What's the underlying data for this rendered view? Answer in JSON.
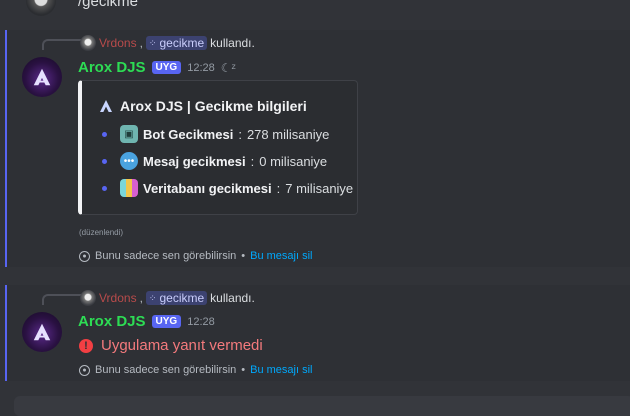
{
  "previous": {
    "text": "/gecikme"
  },
  "messages": [
    {
      "ref_user": "Vrdons",
      "ref_comma": ",",
      "ref_command": "gecikme",
      "ref_action": "kullandı.",
      "author": "Arox DJS",
      "tag": "UYG",
      "time": "12:28",
      "embed": {
        "title": "Arox DJS | Gecikme bilgileri",
        "items": [
          {
            "label": "Bot Gecikmesi",
            "sep": ":",
            "value": "278 milisaniye",
            "icon": "robot-emoji-icon"
          },
          {
            "label": "Mesaj gecikmesi",
            "sep": ":",
            "value": "0 milisaniye",
            "icon": "speech-bubble-emoji-icon"
          },
          {
            "label": "Veritabanı gecikmesi",
            "sep": ":",
            "value": "7 milisaniye",
            "icon": "database-emoji-icon"
          }
        ],
        "accent": "#f2f3f5"
      },
      "edited": "(düzenlendi)",
      "only_you": "Bunu sadece sen görebilirsin",
      "separator": "•",
      "dismiss": "Bu mesajı sil"
    },
    {
      "ref_user": "Vrdons",
      "ref_comma": ",",
      "ref_command": "gecikme",
      "ref_action": "kullandı.",
      "author": "Arox DJS",
      "tag": "UYG",
      "time": "12:28",
      "error": "Uygulama yanıt vermedi",
      "only_you": "Bunu sadece sen görebilirsin",
      "separator": "•",
      "dismiss": "Bu mesajı sil"
    }
  ],
  "colors": {
    "bot_name": "#2ddc54",
    "accent": "#5865f2",
    "error": "#f23f43",
    "link": "#00a8fc"
  }
}
